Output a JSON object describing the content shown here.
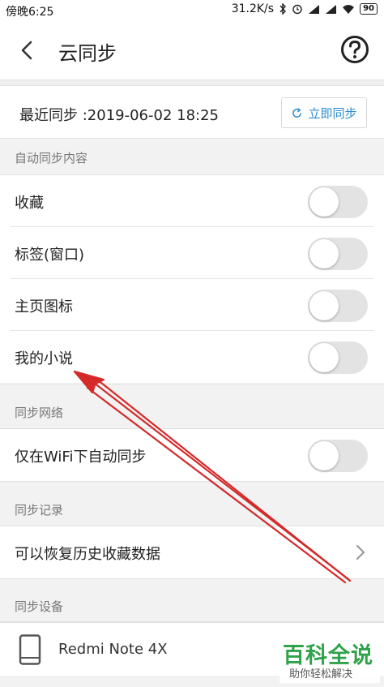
{
  "status_bar": {
    "time": "傍晚6:25",
    "net_speed": "31.2K/s",
    "battery": "90"
  },
  "header": {
    "title": "云同步"
  },
  "last_sync": {
    "text": "最近同步 :2019-06-02 18:25",
    "button_label": "立即同步"
  },
  "sections": {
    "auto_sync": {
      "header": "自动同步内容",
      "items": [
        {
          "label": "收藏",
          "enabled": false
        },
        {
          "label": "标签(窗口)",
          "enabled": false
        },
        {
          "label": "主页图标",
          "enabled": false
        },
        {
          "label": "我的小说",
          "enabled": false
        }
      ]
    },
    "network": {
      "header": "同步网络",
      "items": [
        {
          "label": "仅在WiFi下自动同步",
          "enabled": false
        }
      ]
    },
    "history": {
      "header": "同步记录",
      "items": [
        {
          "label": "可以恢复历史收藏数据"
        }
      ]
    },
    "devices": {
      "header": "同步设备",
      "items": [
        {
          "label": "Redmi Note 4X"
        }
      ]
    }
  },
  "watermark": {
    "title": "百科全说",
    "subtitle": "助你轻松解决"
  },
  "colors": {
    "accent": "#2b8ccf",
    "annotation": "#d42a2a",
    "watermark": "#2fa24a"
  }
}
